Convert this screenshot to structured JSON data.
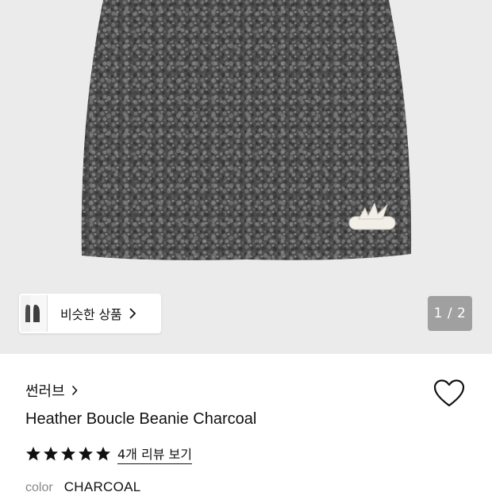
{
  "gallery": {
    "page_counter": "1 / 2",
    "current_page": 1,
    "total_pages": 2,
    "similar_products_label": "비슷한 상품",
    "beanie_color": "#4a4a4a",
    "background_color": "#ebebeb"
  },
  "product": {
    "brand": "썬러브",
    "title": "Heather Boucle Beanie Charcoal",
    "rating": 5,
    "rating_max": 5,
    "review_link": "4개 리뷰 보기",
    "color_label": "color",
    "color_value": "CHARCOAL"
  },
  "icons": {
    "chip_chevron": "chevron-right-icon",
    "brand_chevron": "chevron-right-icon",
    "wishlist": "heart-outline-icon",
    "star": "star-filled-icon"
  }
}
